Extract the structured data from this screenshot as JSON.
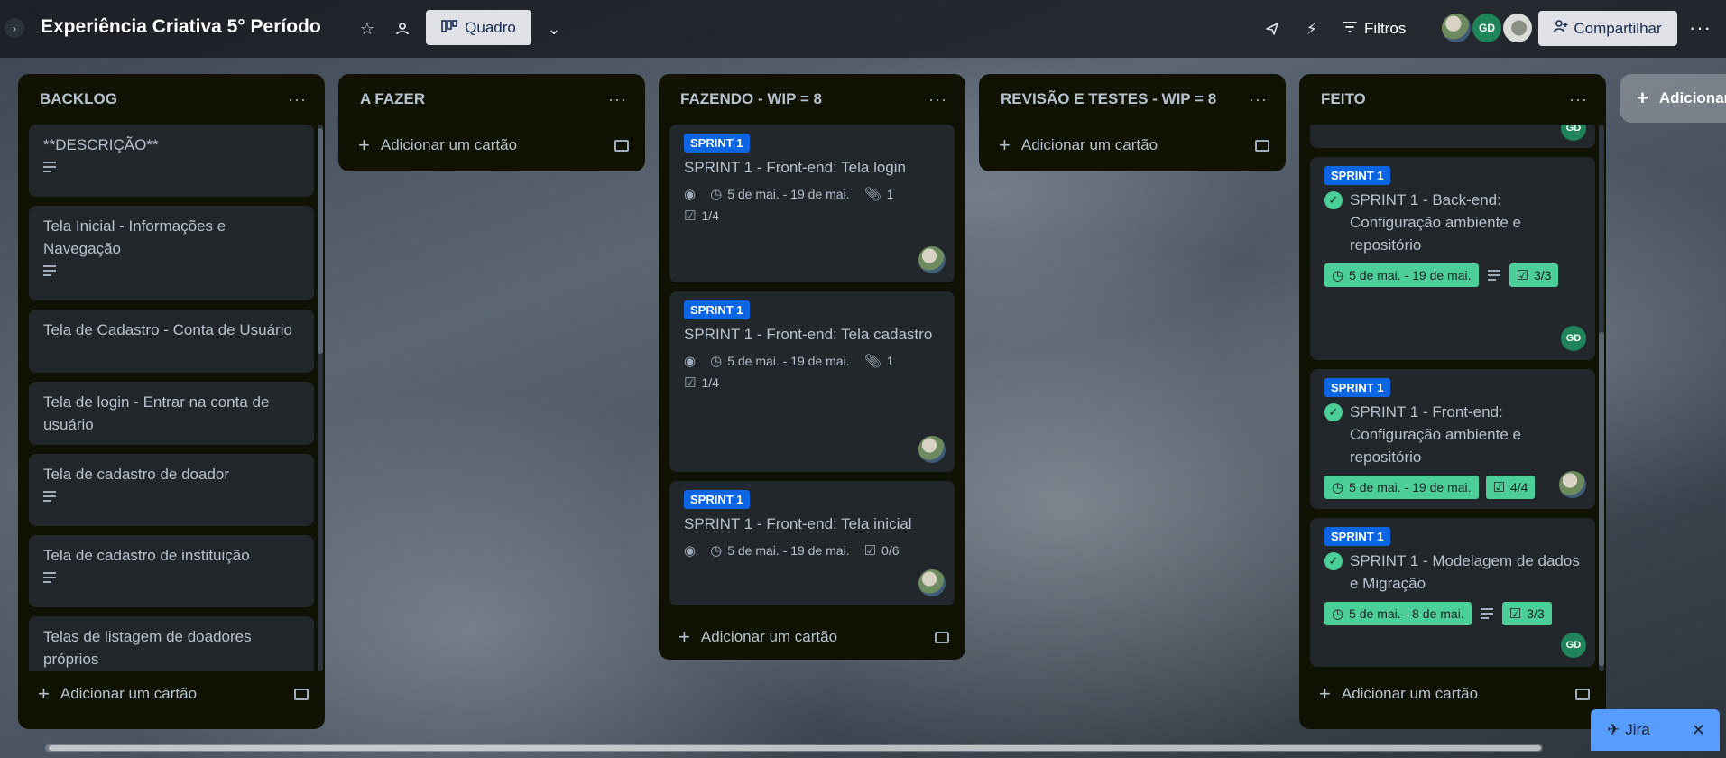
{
  "header": {
    "board_title": "Experiência Criativa 5° Período",
    "view_label": "Quadro",
    "filters_label": "Filtros",
    "share_label": "Compartilhar",
    "avatar_initials": "GD"
  },
  "lists": [
    {
      "title": "BACKLOG",
      "add_label": "Adicionar um cartão",
      "cards": [
        {
          "title": "**DESCRIÇÃO**"
        },
        {
          "title": "Tela Inicial - Informações e Navegação"
        },
        {
          "title": "Tela de Cadastro - Conta de Usuário"
        },
        {
          "title": "Tela de login - Entrar na conta de usuário"
        },
        {
          "title": "Tela de cadastro de doador"
        },
        {
          "title": "Tela de cadastro de instituição"
        },
        {
          "title": "Telas de listagem de doadores próprios"
        }
      ]
    },
    {
      "title": "A FAZER",
      "add_label": "Adicionar um cartão",
      "cards": []
    },
    {
      "title": "FAZENDO - WIP = 8",
      "add_label": "Adicionar um cartão",
      "cards": [
        {
          "label": "SPRINT 1",
          "title": "SPRINT 1 - Front-end: Tela login",
          "dates": "5 de mai. - 19 de mai.",
          "attachments": "1",
          "checklist": "1/4"
        },
        {
          "label": "SPRINT 1",
          "title": "SPRINT 1 - Front-end: Tela cadastro",
          "dates": "5 de mai. - 19 de mai.",
          "attachments": "1",
          "checklist": "1/4"
        },
        {
          "label": "SPRINT 1",
          "title": "SPRINT 1 - Front-end: Tela inicial",
          "dates": "5 de mai. - 19 de mai.",
          "checklist": "0/6"
        }
      ]
    },
    {
      "title": "REVISÃO E TESTES - WIP = 8",
      "add_label": "Adicionar um cartão",
      "cards": []
    },
    {
      "title": "FEITO",
      "add_label": "Adicionar um cartão",
      "cards": [
        {
          "label": "SPRINT 1",
          "title": "SPRINT 1 - Back-end: Configuração ambiente e repositório",
          "dates": "5 de mai. - 19 de mai.",
          "checklist": "3/3",
          "member": "GD"
        },
        {
          "label": "SPRINT 1",
          "title": "SPRINT 1 - Front-end: Configuração ambiente e repositório",
          "dates": "5 de mai. - 19 de mai.",
          "checklist": "4/4"
        },
        {
          "label": "SPRINT 1",
          "title": "SPRINT 1 - Modelagem de dados e Migração",
          "dates": "5 de mai. - 8 de mai.",
          "checklist": "3/3",
          "member": "GD"
        }
      ],
      "partial_card_member": "GD"
    }
  ],
  "add_list_label": "Adicionar",
  "jira": {
    "label": "Jira"
  },
  "colors": {
    "label_blue": "#0c66e4",
    "done_green": "#4bce97",
    "member_green": "#1f845a",
    "list_bg": "#101204",
    "card_bg": "#22272b"
  },
  "icons": [
    "chevron-right-icon",
    "star-icon",
    "workspace-visibility-icon",
    "board-view-icon",
    "chevron-down-icon",
    "send-icon",
    "automation-bolt-icon",
    "filter-icon",
    "add-person-icon",
    "ellipsis-icon",
    "eye-icon",
    "clock-icon",
    "paperclip-icon",
    "checklist-icon",
    "description-icon",
    "check-circle-icon",
    "plus-icon",
    "template-icon",
    "close-icon"
  ]
}
